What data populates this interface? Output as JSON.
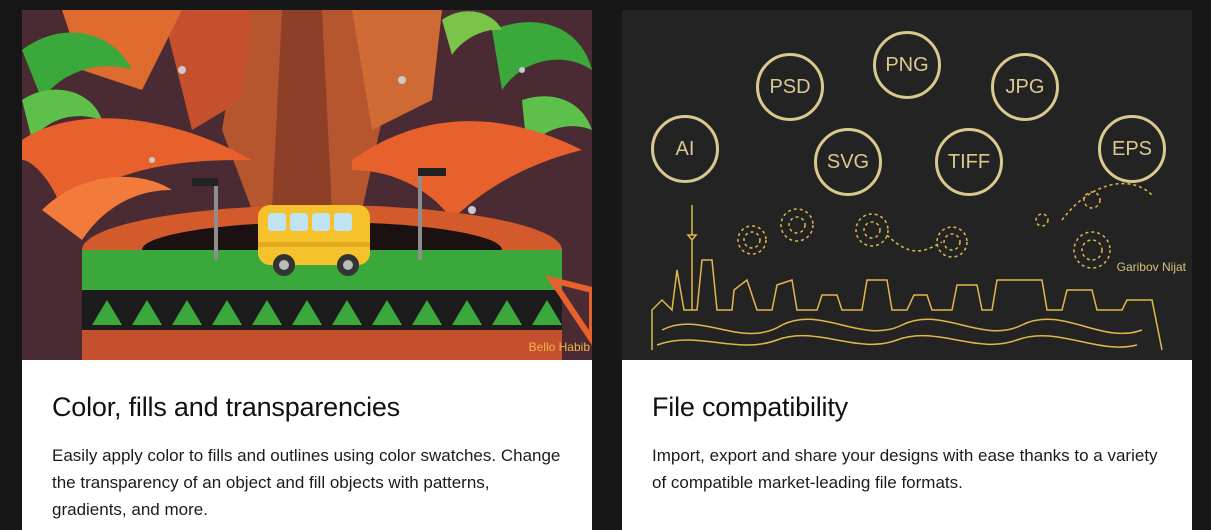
{
  "cards": [
    {
      "title": "Color, fills and transparencies",
      "text": "Easily apply color to fills and outlines using color swatches. Change the transparency of an object and fill objects with patterns, gradients, and more.",
      "credit": "Bello Habib",
      "palette": {
        "background": "#4a2a33",
        "green": "#3aa83a",
        "orange": "#e8612c",
        "bus": "#f5c22c"
      }
    },
    {
      "title": "File compatibility",
      "text": "Import, export and share your designs with ease thanks to a variety of compatible market-leading file formats.",
      "credit": "Garibov Nijat",
      "formats": [
        "PSD",
        "PNG",
        "JPG",
        "AI",
        "SVG",
        "TIFF",
        "EPS"
      ],
      "palette": {
        "background": "#232323",
        "line": "#d9c98f",
        "skyline": "#e0b84a"
      }
    }
  ]
}
